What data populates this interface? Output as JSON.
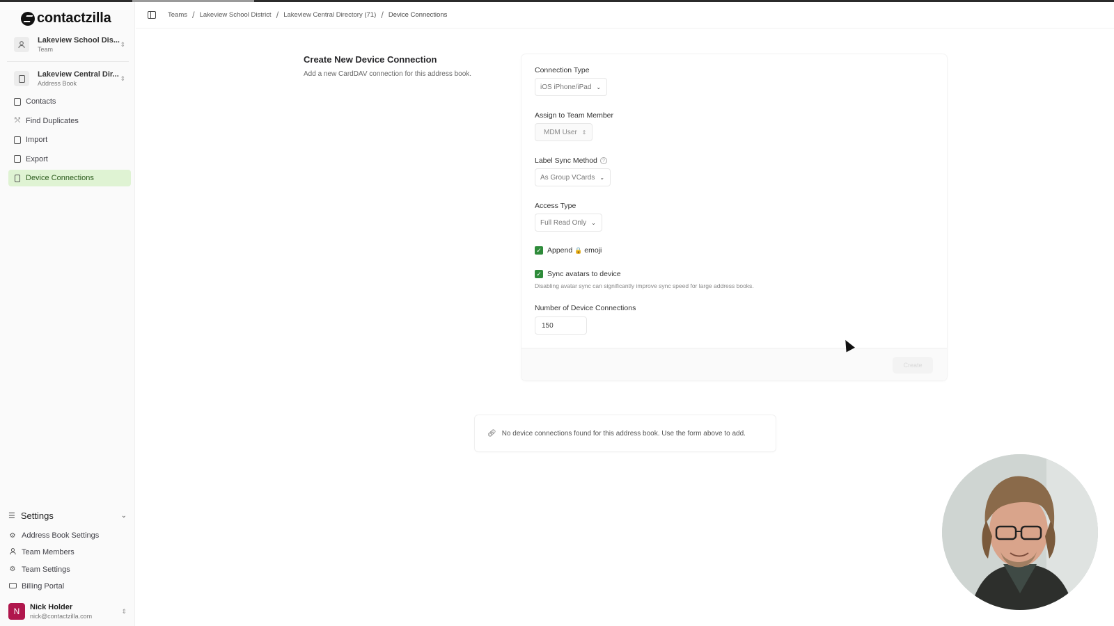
{
  "app": {
    "name": "contactzilla"
  },
  "team_switcher": {
    "title": "Lakeview School Dis...",
    "subtitle": "Team"
  },
  "book_switcher": {
    "title": "Lakeview Central Dir...",
    "subtitle": "Address Book"
  },
  "nav": [
    {
      "label": "Contacts",
      "icon": "contacts-icon"
    },
    {
      "label": "Find Duplicates",
      "icon": "merge-icon"
    },
    {
      "label": "Import",
      "icon": "import-icon"
    },
    {
      "label": "Export",
      "icon": "export-icon"
    },
    {
      "label": "Device Connections",
      "icon": "device-icon",
      "active": true
    }
  ],
  "settings": {
    "title": "Settings",
    "items": [
      {
        "label": "Address Book Settings",
        "icon": "gear-icon"
      },
      {
        "label": "Team Members",
        "icon": "users-icon"
      },
      {
        "label": "Team Settings",
        "icon": "gear-icon"
      },
      {
        "label": "Billing Portal",
        "icon": "card-icon"
      }
    ]
  },
  "user": {
    "initial": "N",
    "name": "Nick Holder",
    "email": "nick@contactzilla.com"
  },
  "breadcrumb": [
    "Teams",
    "Lakeview School District",
    "Lakeview Central Directory (71)",
    "Device Connections"
  ],
  "form": {
    "title": "Create New Device Connection",
    "description": "Add a new CardDAV connection for this address book.",
    "connection_type": {
      "label": "Connection Type",
      "value": "iOS iPhone/iPad"
    },
    "assign_member": {
      "label": "Assign to Team Member",
      "value": "MDM User"
    },
    "label_sync": {
      "label": "Label Sync Method",
      "value": "As Group VCards"
    },
    "access_type": {
      "label": "Access Type",
      "value": "Full Read Only"
    },
    "append_emoji": {
      "label_pre": "Append",
      "emoji": "🔒",
      "label_post": "emoji",
      "checked": true
    },
    "sync_avatars": {
      "label": "Sync avatars to device",
      "checked": true,
      "hint": "Disabling avatar sync can significantly improve sync speed for large address books."
    },
    "num_connections": {
      "label": "Number of Device Connections",
      "value": "150"
    },
    "submit_label": "Create"
  },
  "empty_state": {
    "text": "No device connections found for this address book. Use the form above to add."
  },
  "colors": {
    "accent_green": "#2e8b3a",
    "active_nav_bg": "#dff3d3",
    "avatar_bg": "#b0174d"
  }
}
